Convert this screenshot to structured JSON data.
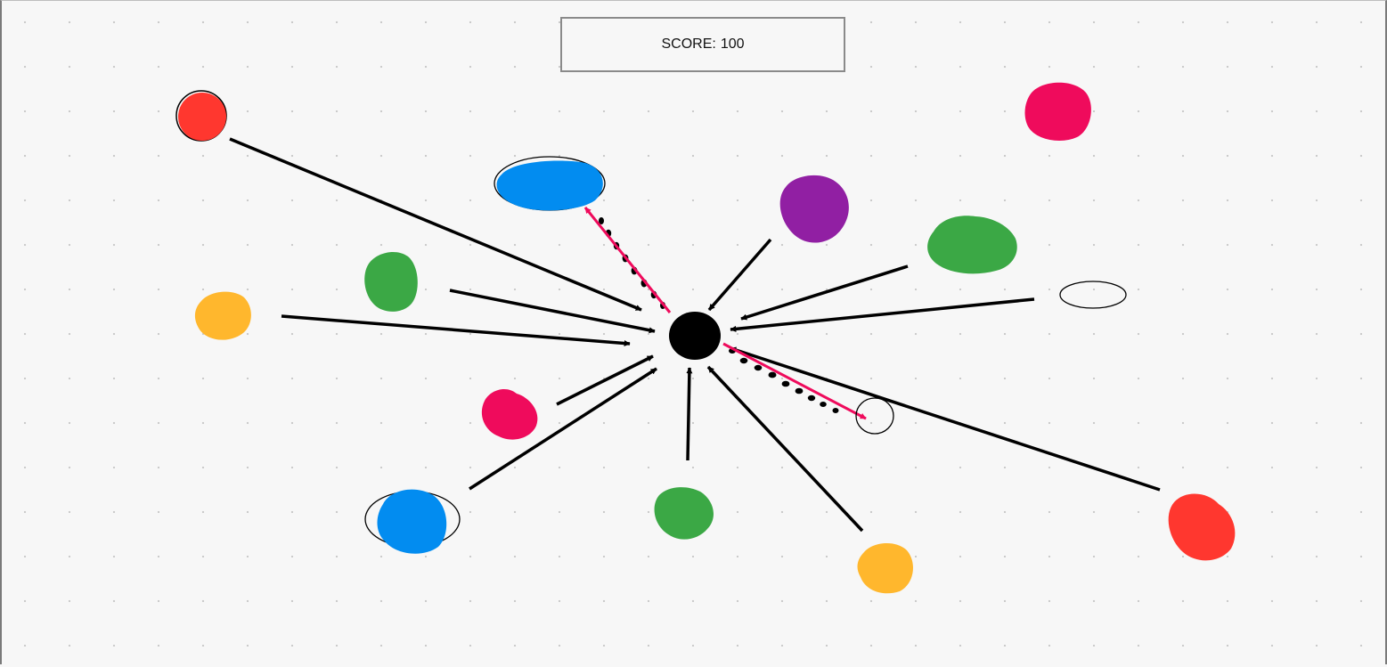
{
  "game": {
    "score_label": "SCORE:",
    "score_value": "100"
  },
  "colors": {
    "red": "#ff372f",
    "crimson": "#ef0b5c",
    "blue": "#028cf0",
    "purple": "#911fa3",
    "green": "#3ba845",
    "yellow": "#ffb72d",
    "player": "#000000",
    "arrow": "#000000",
    "highlight_arrow": "#ef0b5c",
    "outline": "#000000"
  },
  "blobs": [
    {
      "id": "red-top-left",
      "color": "red"
    },
    {
      "id": "crimson-top-right",
      "color": "crimson"
    },
    {
      "id": "blue-top",
      "color": "blue",
      "outlined": true
    },
    {
      "id": "purple-top",
      "color": "purple"
    },
    {
      "id": "green-top-right",
      "color": "green"
    },
    {
      "id": "green-left",
      "color": "green"
    },
    {
      "id": "yellow-left",
      "color": "yellow"
    },
    {
      "id": "crimson-center-left",
      "color": "crimson"
    },
    {
      "id": "blue-bottom-left",
      "color": "blue",
      "outlined": true
    },
    {
      "id": "green-bottom",
      "color": "green"
    },
    {
      "id": "yellow-bottom",
      "color": "yellow"
    },
    {
      "id": "red-bottom-right",
      "color": "red"
    }
  ],
  "empty_targets": [
    {
      "id": "empty-ellipse-right"
    },
    {
      "id": "empty-circle-target"
    }
  ]
}
